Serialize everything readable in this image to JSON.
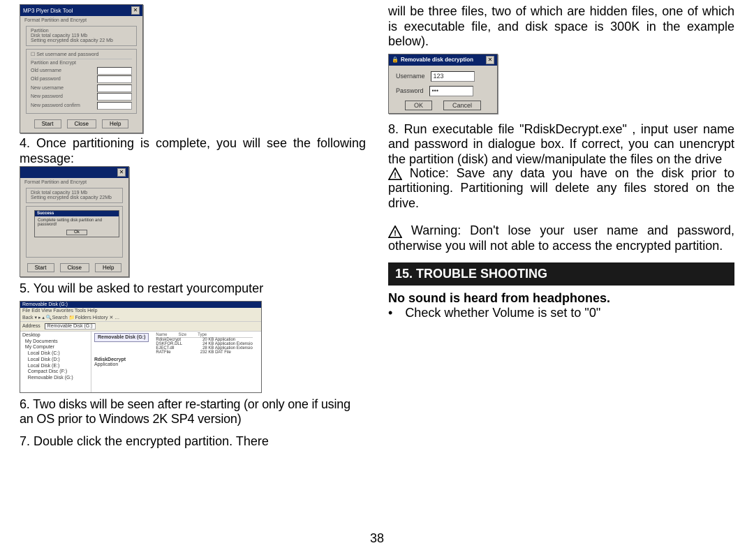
{
  "left": {
    "disk_tool": {
      "title": "MP3 Plyer Disk Tool",
      "tab": "Format   Partition and Encrypt",
      "partition_group": "Partition",
      "cap_line": "Disk total capacity 119 Mb",
      "setting_line": "Setting encrypted disk capacity 22 Mb",
      "set_unp": "Set username and password",
      "pe_group": "Partition and Encrypt",
      "old_user": "Old username",
      "old_pass": "Old password",
      "new_user": "New username",
      "new_pass": "New password",
      "new_pass_confirm": "New password confirm",
      "btn_start": "Start",
      "btn_close": "Close",
      "btn_help": "Help"
    },
    "p4": "4. Once partitioning is complete, you will see the following message:",
    "disk_tool2": {
      "tab": "Format   Partition and Encrypt",
      "cap_line": "Disk total capacity 119 Mb",
      "setting_line": "Setting encrypted disk capacity 22Mb",
      "success_title": "Success",
      "success_msg": "Complete setting disk partition and password!",
      "ok": "Ok",
      "btn_start": "Start",
      "btn_close": "Close",
      "btn_help": "Help"
    },
    "p5": "5. You will be asked to restart yourcomputer",
    "explorer": {
      "title": "Removable Disk (G:)",
      "menu": "File  Edit  View  Favorites  Tools  Help",
      "toolbar": "Back ▾  ▸  ▴  🔍Search  📁Folders  History  ✕  …",
      "addr_label": "Address",
      "addr_value": "Removable Disk (G:)",
      "tree": [
        "Desktop",
        "  My Documents",
        "  My Computer",
        "    Local Disk (C:)",
        "    Local Disk (D:)",
        "    Local Disk (E:)",
        "    Compact Disc (F:)",
        "    Removable Disk (G:)"
      ],
      "drive_label": "Removable Disk (G:)",
      "decrypt_entry": "RdiskDecrypt",
      "decrypt_sub": "Application",
      "hdr_name": "Name",
      "hdr_size": "Size",
      "hdr_type": "Type",
      "rows": [
        {
          "n": "RdiskDecrypt",
          "s": "20 KB",
          "t": "Application"
        },
        {
          "n": "DSKFOR.DLL",
          "s": "24 KB",
          "t": "Application Extensio"
        },
        {
          "n": "EJECT.dll",
          "s": "28 KB",
          "t": "Application Extensio"
        },
        {
          "n": "RATFile",
          "s": "232 KB",
          "t": "DAT File"
        }
      ]
    },
    "p6": "6. Two disks will be seen after re-starting (or only one if using an OS prior to Windows 2K SP4 version)",
    "p7": "7. Double click the encrypted partition. There"
  },
  "right": {
    "p_top": "will be three files, two of which are hidden files, one of which is executable file, and disk space is 300K in the example below).",
    "decrypt": {
      "title": "Removable disk decryption",
      "user_label": "Username",
      "user_value": "123",
      "pass_label": "Password",
      "pass_value": "•••",
      "ok": "OK",
      "cancel": "Cancel"
    },
    "p8": "8. Run executable file \"RdiskDecrypt.exe\" , input user name and password in dialogue box. If correct, you can unencrypt the partition (disk) and view/manipulate the files on the drive",
    "notice": " Notice: Save any data you have on the disk prior to partitioning.  Partitioning will delete any files stored on the drive.",
    "warning": " Warning: Don't lose your user name and password, otherwise you will not able to access the encrypted partition.",
    "section_header": "15. TROUBLE SHOOTING",
    "sub_bold": "No sound is heard from headphones.",
    "bullet": "Check whether Volume is set to \"0\""
  },
  "page_num": "38"
}
